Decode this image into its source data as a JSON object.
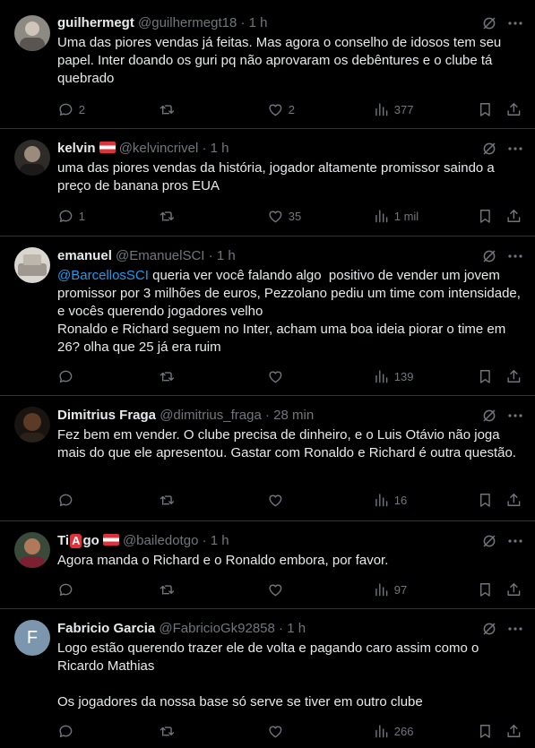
{
  "tweets": [
    {
      "display_name": "guilhermegt",
      "handle": "@guilhermegt18",
      "dot": "·",
      "time": "1 h",
      "flag": false,
      "text_parts": [
        "Uma das piores vendas já feitas. Mas agora o conselho de idosos tem seu papel. Inter doando os guri pq não aprovaram os debêntures e o clube tá quebrado"
      ],
      "replies": "2",
      "retweets": "",
      "likes": "2",
      "views": "377"
    },
    {
      "display_name": "kelvin",
      "handle": "@kelvincrivel",
      "dot": "·",
      "time": "1 h",
      "flag": true,
      "text_parts": [
        "uma das piores vendas da história, jogador altamente promissor saindo a preço de banana pros EUA"
      ],
      "replies": "1",
      "retweets": "",
      "likes": "35",
      "views": "1 mil"
    },
    {
      "display_name": "emanuel",
      "handle": "@EmanuelSCI",
      "dot": "·",
      "time": "1 h",
      "flag": false,
      "mention": "@BarcellosSCI",
      "text_parts": [
        " queria ver você falando algo  positivo de vender um jovem promissor por 3 milhões de euros, Pezzolano pediu um time com intensidade, e vocês querendo jogadores velho\nRonaldo e Richard seguem no Inter, acham uma boa ideia piorar o time em 26? olha que 25 já era ruim"
      ],
      "replies": "",
      "retweets": "",
      "likes": "",
      "views": "139"
    },
    {
      "display_name": "Dimitrius Fraga",
      "handle": "@dimitrius_fraga",
      "dot": "·",
      "time": "28 min",
      "flag": false,
      "text_parts": [
        "Fez bem em vender. O clube precisa de dinheiro, e o Luis Otávio não joga mais do que ele apresentou. Gastar com Ronaldo e Richard é outra questão."
      ],
      "replies": "",
      "retweets": "",
      "likes": "",
      "views": "16"
    },
    {
      "display_name_pre": "Ti",
      "display_name_emoji": "A",
      "display_name_post": "go",
      "handle": "@bailedotgo",
      "dot": "·",
      "time": "1 h",
      "flag": true,
      "text_parts": [
        "Agora manda o Richard e o Ronaldo embora, por favor."
      ],
      "replies": "",
      "retweets": "",
      "likes": "",
      "views": "97"
    },
    {
      "display_name": "Fabricio Garcia",
      "handle": "@FabricioGk92858",
      "dot": "·",
      "time": "1 h",
      "flag": false,
      "avatar_letter": "F",
      "text_parts": [
        "Logo estão querendo trazer ele de volta e pagando caro assim como o Ricardo Mathias\n\nOs jogadores da nossa base só serve se tiver em outro clube"
      ],
      "replies": "",
      "retweets": "",
      "likes": "",
      "views": "266"
    }
  ],
  "colors": {
    "background": "#000000",
    "text": "#e7e9ea",
    "muted": "#71767b",
    "link": "#1d9bf0",
    "divider": "#2f3336",
    "flag_red": "#e0303a"
  },
  "icons": [
    "reply-icon",
    "retweet-icon",
    "like-icon",
    "views-icon",
    "bookmark-icon",
    "share-icon",
    "grok-icon",
    "more-icon"
  ]
}
